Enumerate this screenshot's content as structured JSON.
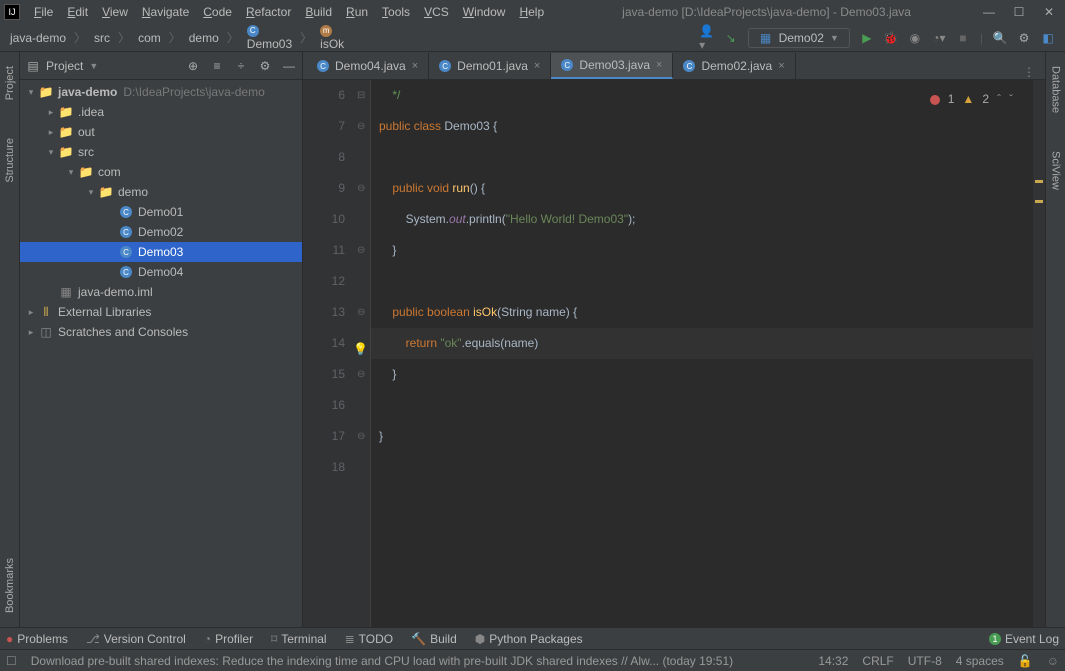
{
  "window": {
    "title": "java-demo [D:\\IdeaProjects\\java-demo] - Demo03.java"
  },
  "menu": {
    "items": [
      "File",
      "Edit",
      "View",
      "Navigate",
      "Code",
      "Refactor",
      "Build",
      "Run",
      "Tools",
      "VCS",
      "Window",
      "Help"
    ]
  },
  "breadcrumb": {
    "items": [
      "java-demo",
      "src",
      "com",
      "demo",
      "Demo03",
      "isOk"
    ]
  },
  "runconfig": {
    "name": "Demo02"
  },
  "project": {
    "header": "Project",
    "root": {
      "name": "java-demo",
      "path": "D:\\IdeaProjects\\java-demo"
    },
    "idea": ".idea",
    "out": "out",
    "src": "src",
    "com": "com",
    "demo": "demo",
    "classes": [
      "Demo01",
      "Demo02",
      "Demo03",
      "Demo04"
    ],
    "iml": "java-demo.iml",
    "extlibs": "External Libraries",
    "scratches": "Scratches and Consoles"
  },
  "tabs": [
    {
      "label": "Demo04.java",
      "active": false
    },
    {
      "label": "Demo01.java",
      "active": false
    },
    {
      "label": "Demo03.java",
      "active": true
    },
    {
      "label": "Demo02.java",
      "active": false
    }
  ],
  "editor": {
    "line_start": 6,
    "line_end": 18,
    "cursor_line": 14,
    "lines": [
      {
        "n": 6,
        "tokens": [
          {
            "t": "    */",
            "c": "cmt"
          }
        ]
      },
      {
        "n": 7,
        "tokens": [
          {
            "t": "public ",
            "c": "kw"
          },
          {
            "t": "class ",
            "c": "kw"
          },
          {
            "t": "Demo03 ",
            "c": "cls"
          },
          {
            "t": "{",
            "c": "par"
          }
        ]
      },
      {
        "n": 8,
        "tokens": []
      },
      {
        "n": 9,
        "tokens": [
          {
            "t": "    ",
            "c": ""
          },
          {
            "t": "public ",
            "c": "kw"
          },
          {
            "t": "void ",
            "c": "kw"
          },
          {
            "t": "run",
            "c": "mth"
          },
          {
            "t": "() {",
            "c": "par"
          }
        ]
      },
      {
        "n": 10,
        "tokens": [
          {
            "t": "        System.",
            "c": "cls"
          },
          {
            "t": "out",
            "c": "fld"
          },
          {
            "t": ".println(",
            "c": "par"
          },
          {
            "t": "\"Hello World! Demo03\"",
            "c": "str"
          },
          {
            "t": ");",
            "c": "par"
          }
        ]
      },
      {
        "n": 11,
        "tokens": [
          {
            "t": "    }",
            "c": "par"
          }
        ]
      },
      {
        "n": 12,
        "tokens": []
      },
      {
        "n": 13,
        "tokens": [
          {
            "t": "    ",
            "c": ""
          },
          {
            "t": "public ",
            "c": "kw"
          },
          {
            "t": "boolean ",
            "c": "kw"
          },
          {
            "t": "isOk",
            "c": "mth"
          },
          {
            "t": "(String ",
            "c": "par"
          },
          {
            "t": "name",
            "c": "cls"
          },
          {
            "t": ") {",
            "c": "par"
          }
        ]
      },
      {
        "n": 14,
        "tokens": [
          {
            "t": "        ",
            "c": ""
          },
          {
            "t": "return ",
            "c": "kw"
          },
          {
            "t": "\"ok\"",
            "c": "str"
          },
          {
            "t": ".equals(",
            "c": "par"
          },
          {
            "t": "name",
            "c": "cls"
          },
          {
            "t": ")",
            "c": "par"
          }
        ]
      },
      {
        "n": 15,
        "tokens": [
          {
            "t": "    }",
            "c": "par"
          }
        ]
      },
      {
        "n": 16,
        "tokens": []
      },
      {
        "n": 17,
        "tokens": [
          {
            "t": "}",
            "c": "par"
          }
        ]
      },
      {
        "n": 18,
        "tokens": []
      }
    ]
  },
  "inspections": {
    "errors": "1",
    "warnings": "2"
  },
  "bottomtabs": {
    "problems": "Problems",
    "version": "Version Control",
    "profiler": "Profiler",
    "terminal": "Terminal",
    "todo": "TODO",
    "build": "Build",
    "python": "Python Packages",
    "eventlog": "Event Log"
  },
  "statusbar": {
    "msg": "Download pre-built shared indexes: Reduce the indexing time and CPU load with pre-built JDK shared indexes // Alw... (today 19:51)",
    "pos": "14:32",
    "eol": "CRLF",
    "enc": "UTF-8",
    "indent": "4 spaces"
  },
  "left_tabs": [
    "Project",
    "Structure",
    "Bookmarks"
  ],
  "right_tabs": [
    "Database",
    "SciView"
  ]
}
